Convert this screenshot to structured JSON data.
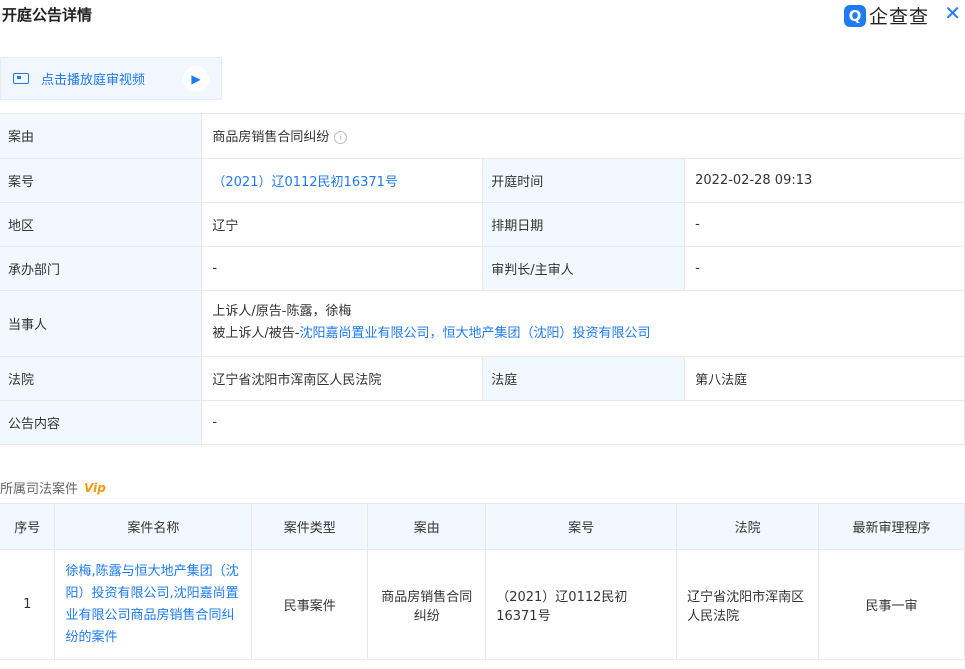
{
  "header": {
    "title": "开庭公告详情",
    "brand": "企查查",
    "brand_badge": "Q",
    "close": "✕"
  },
  "video_button": {
    "label": "点击播放庭审视频"
  },
  "info": {
    "case_reason_label": "案由",
    "case_reason_value": "商品房销售合同纠纷",
    "case_no_label": "案号",
    "case_no_value": "（2021）辽0112民初16371号",
    "hearing_time_label": "开庭时间",
    "hearing_time_value": "2022-02-28 09:13",
    "region_label": "地区",
    "region_value": "辽宁",
    "schedule_label": "排期日期",
    "schedule_value": "-",
    "dept_label": "承办部门",
    "dept_value": "-",
    "judge_label": "审判长/主审人",
    "judge_value": "-",
    "parties_label": "当事人",
    "parties_line1": "上诉人/原告-陈露，徐梅",
    "parties_line2_prefix": "被上诉人/被告-",
    "defendant1": "沈阳嘉尚置业有限公司",
    "sep": "，",
    "defendant2": "恒大地产集团（沈阳）投资有限公司",
    "court_label": "法院",
    "court_value": "辽宁省沈阳市浑南区人民法院",
    "room_label": "法庭",
    "room_value": "第八法庭",
    "content_label": "公告内容",
    "content_value": "-"
  },
  "related": {
    "section_title": "所属司法案件",
    "vip_badge": "Vip",
    "columns": [
      "序号",
      "案件名称",
      "案件类型",
      "案由",
      "案号",
      "法院",
      "最新审理程序"
    ],
    "rows": [
      {
        "index": "1",
        "name": "徐梅,陈露与恒大地产集团（沈阳）投资有限公司,沈阳嘉尚置业有限公司商品房销售合同纠纷的案件",
        "type": "民事案件",
        "reason": "商品房销售合同纠纷",
        "case_no": "（2021）辽0112民初16371号",
        "court": "辽宁省沈阳市浑南区人民法院",
        "stage": "民事一审"
      }
    ]
  }
}
